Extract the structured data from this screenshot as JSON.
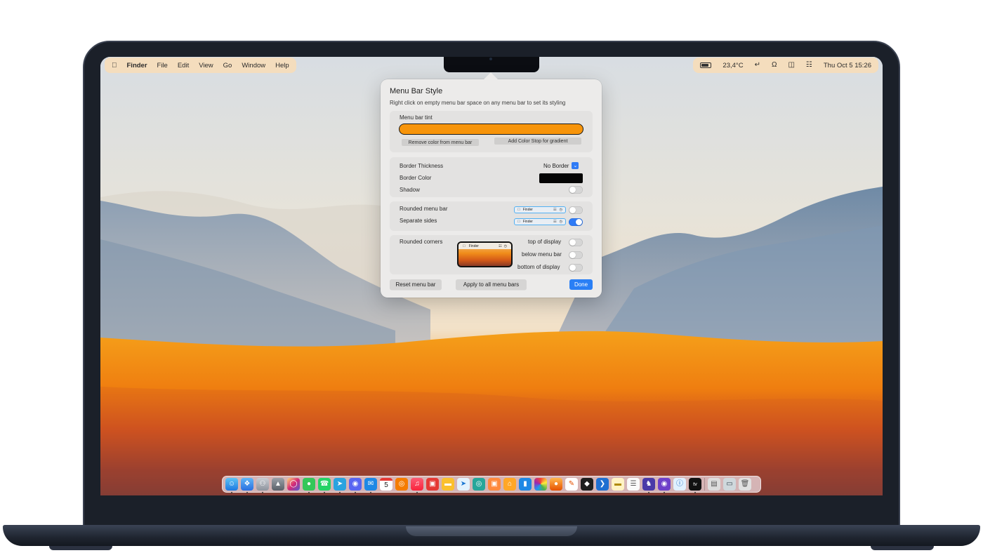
{
  "menubar": {
    "app_name": "Finder",
    "menus": [
      "File",
      "Edit",
      "View",
      "Go",
      "Window",
      "Help"
    ],
    "temperature": "23,4°C",
    "datetime": "Thu Oct 5  15:26"
  },
  "popover": {
    "title": "Menu Bar Style",
    "subtitle": "Right click on empty menu bar space on any menu bar to set its styling",
    "tint": {
      "label": "Menu bar tint",
      "color": "#f7940a",
      "remove_button": "Remove color from menu bar",
      "add_stop_button": "Add Color Stop for gradient"
    },
    "border": {
      "thickness_label": "Border Thickness",
      "thickness_value": "No Border",
      "color_label": "Border Color",
      "color_value": "#050505",
      "shadow_label": "Shadow",
      "shadow_on": false
    },
    "shape": {
      "rounded_label": "Rounded menu bar",
      "rounded_on": false,
      "separate_label": "Separate sides",
      "separate_on": true,
      "preview_app": "Finder"
    },
    "corners": {
      "label": "Rounded corners",
      "top_label": "top of display",
      "top_on": false,
      "below_label": "below menu bar",
      "below_on": false,
      "bottom_label": "bottom of display",
      "bottom_on": false
    },
    "buttons": {
      "reset": "Reset menu bar",
      "apply_all": "Apply to all menu bars",
      "done": "Done"
    }
  },
  "dock": {
    "calendar_day": "5",
    "appletv_label": "tv"
  },
  "colors": {
    "accent": "#2f7bf6",
    "tint": "#f7940a",
    "menubar_bg": "#f6dcba"
  }
}
